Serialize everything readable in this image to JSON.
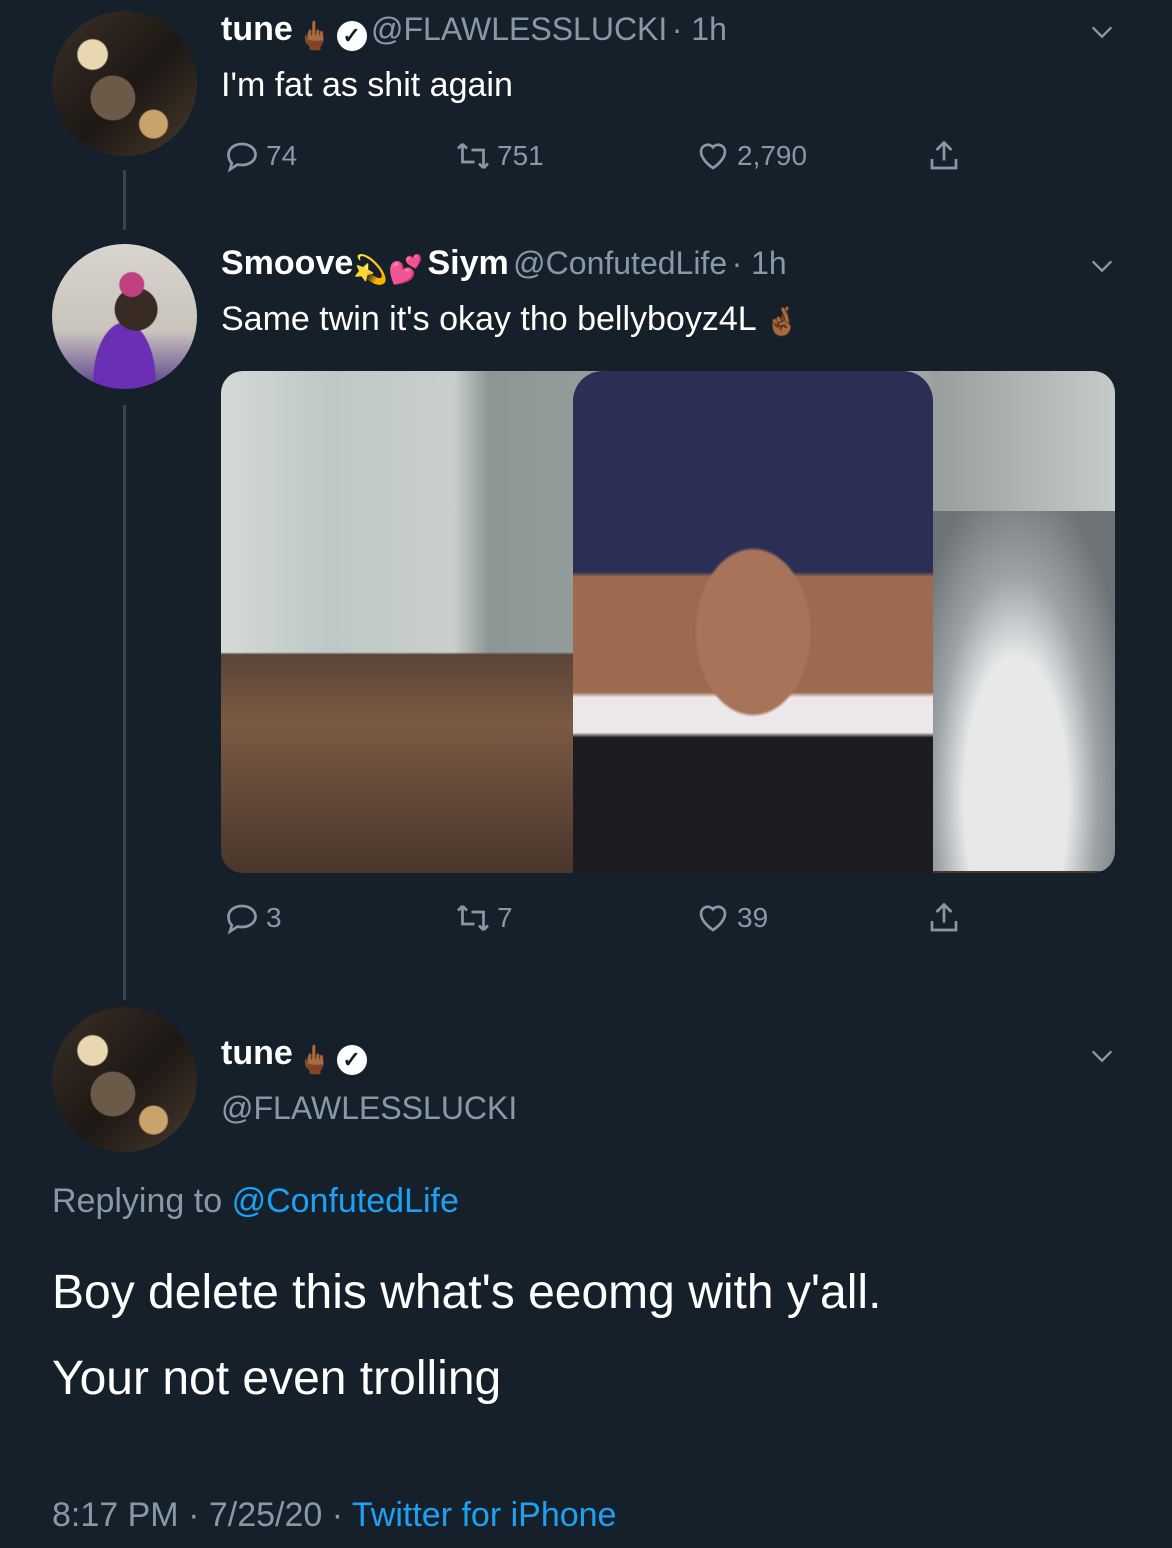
{
  "tweet1": {
    "name": "tune",
    "name_emoji": "🖕🏾",
    "handle": "@FLAWLESSLUCKI",
    "time": "· 1h",
    "text": "I'm fat as shit again",
    "replies": "74",
    "retweets": "751",
    "likes": "2,790"
  },
  "tweet2": {
    "name": "Smoove",
    "name_emoji": "💫💕",
    "name2": "Siym",
    "handle": "@ConfutedLife",
    "time": "· 1h",
    "text": "Same twin it's okay tho bellyboyz4L",
    "text_emoji": "🤞🏾",
    "replies": "3",
    "retweets": "7",
    "likes": "39"
  },
  "tweet3": {
    "name": "tune",
    "name_emoji": "🖕🏾",
    "handle": "@FLAWLESSLUCKI",
    "replying_prefix": "Replying to",
    "replying_mention": "@ConfutedLife",
    "line1": "Boy delete this what's eeomg with y'all.",
    "line2": "Your not even trolling",
    "time": "8:17 PM · 7/25/20 ·",
    "source": "Twitter for iPhone"
  },
  "colors": {
    "background": "#15202b",
    "secondary_text": "#8899a6",
    "link": "#1da1f2"
  },
  "icons": [
    "reply-icon",
    "retweet-icon",
    "like-icon",
    "share-icon",
    "chevron-down-icon",
    "verified-badge-icon"
  ]
}
